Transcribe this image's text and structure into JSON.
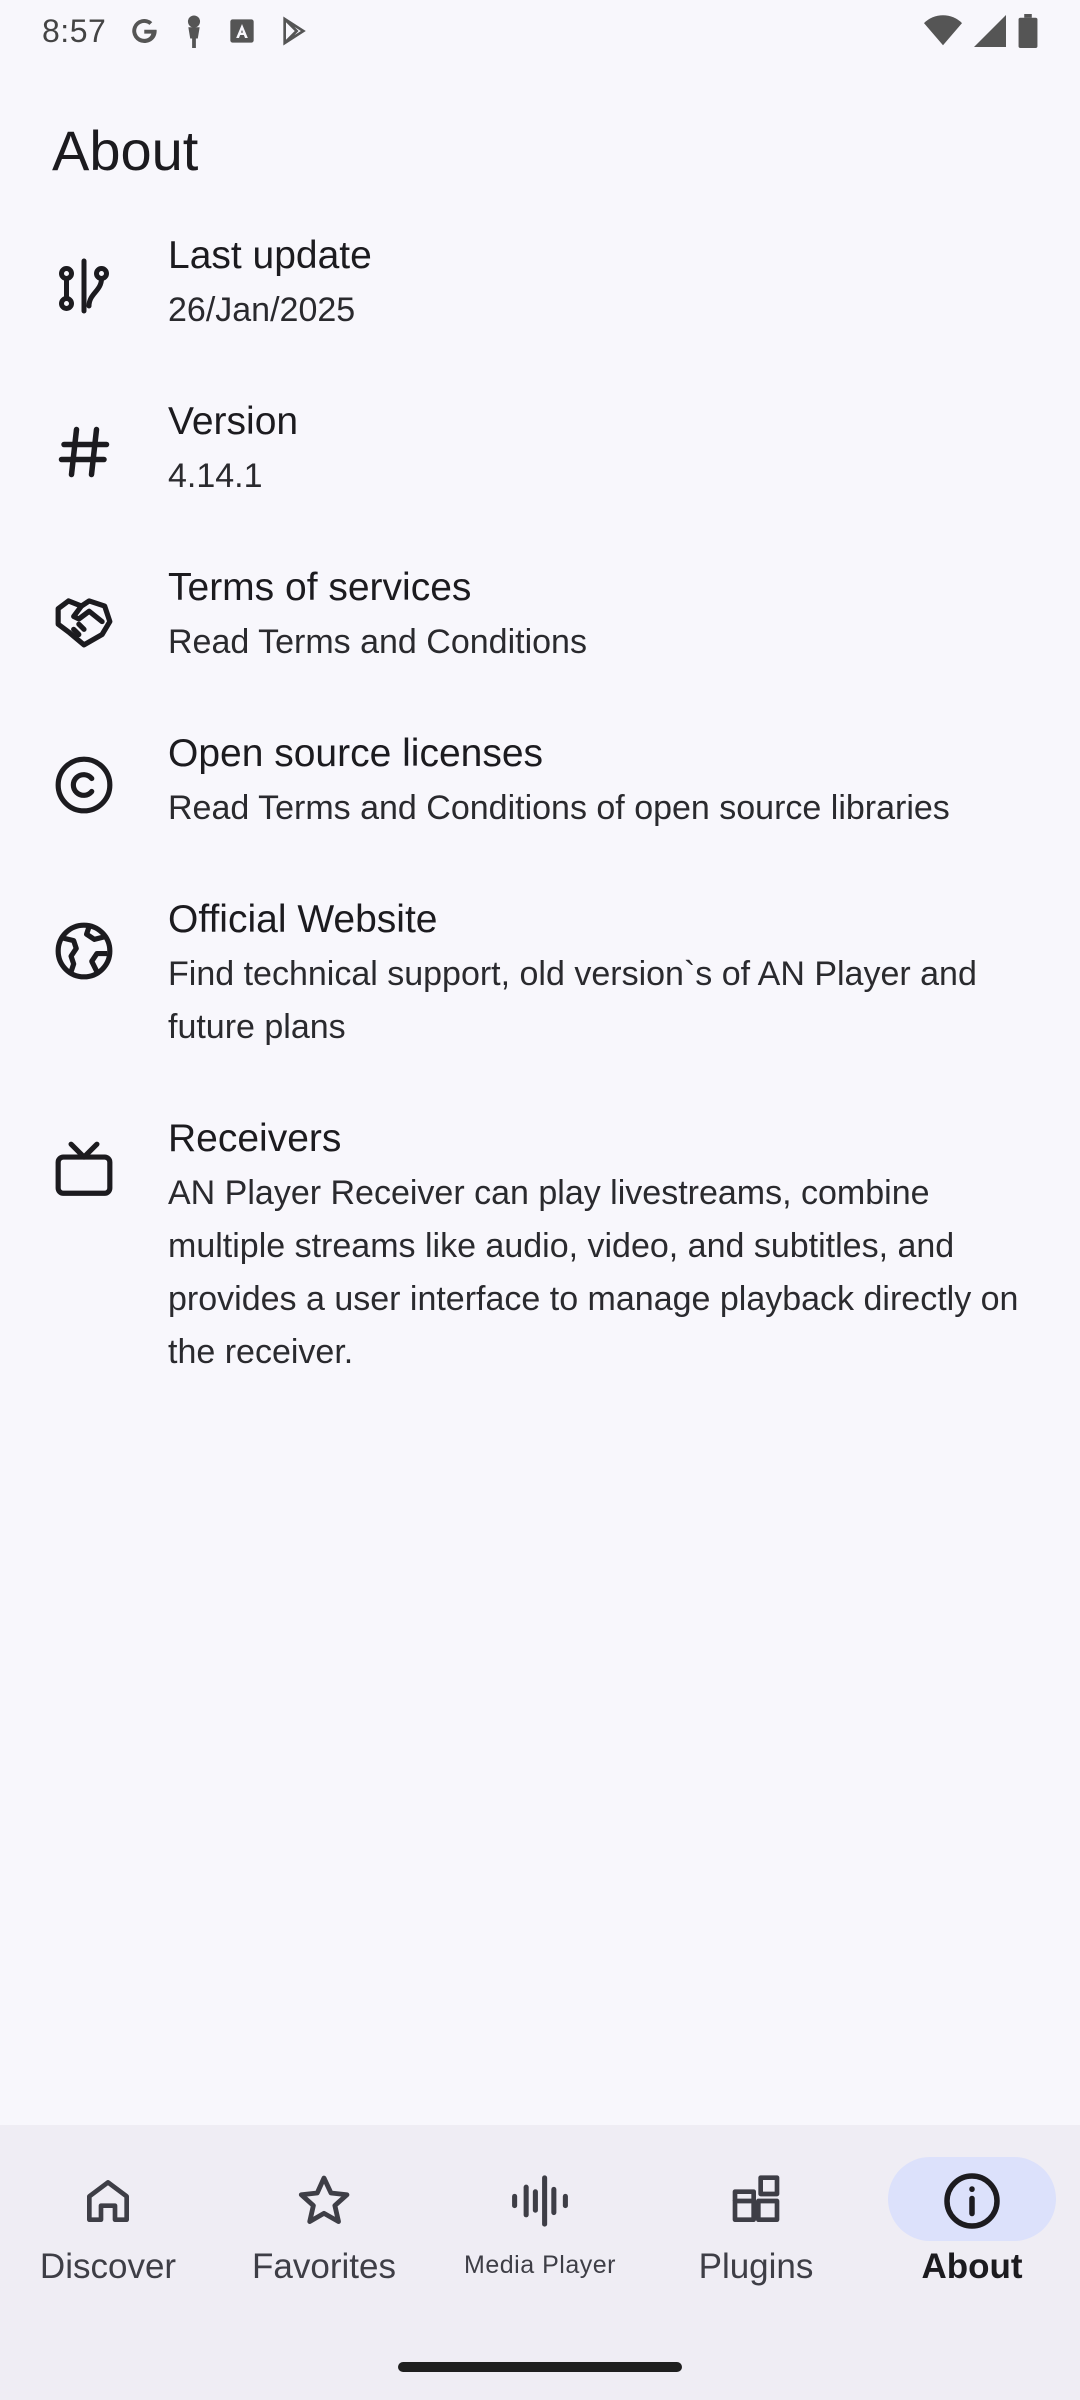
{
  "status_bar": {
    "time": "8:57",
    "icons_left": [
      "google-icon",
      "cast-pin-icon",
      "text-a-icon",
      "play-store-icon"
    ],
    "icons_right": [
      "wifi-icon",
      "signal-icon",
      "battery-icon"
    ]
  },
  "page": {
    "title": "About"
  },
  "items": [
    {
      "icon": "merge-icon",
      "title": "Last update",
      "subtitle": "26/Jan/2025"
    },
    {
      "icon": "hash-icon",
      "title": "Version",
      "subtitle": "4.14.1"
    },
    {
      "icon": "handshake-icon",
      "title": "Terms of services",
      "subtitle": "Read Terms and Conditions"
    },
    {
      "icon": "copyright-icon",
      "title": "Open source licenses",
      "subtitle": "Read Terms and Conditions of open source libraries"
    },
    {
      "icon": "globe-icon",
      "title": "Official Website",
      "subtitle": "Find technical support, old version`s of AN Player and future plans"
    },
    {
      "icon": "tv-icon",
      "title": "Receivers",
      "subtitle": "AN Player Receiver can play livestreams, combine multiple streams like audio, video, and subtitles, and provides a user interface to manage playback directly on the receiver."
    }
  ],
  "bottom_nav": {
    "items": [
      {
        "icon": "home-icon",
        "label": "Discover"
      },
      {
        "icon": "star-icon",
        "label": "Favorites"
      },
      {
        "icon": "waveform-icon",
        "label": "Media Player"
      },
      {
        "icon": "widgets-icon",
        "label": "Plugins"
      },
      {
        "icon": "info-icon",
        "label": "About"
      }
    ],
    "active": "About"
  },
  "colors": {
    "background": "#f8f7fc",
    "nav_background": "#efedf4",
    "active_pill": "#dce1fb",
    "text": "#1c1b1f"
  }
}
